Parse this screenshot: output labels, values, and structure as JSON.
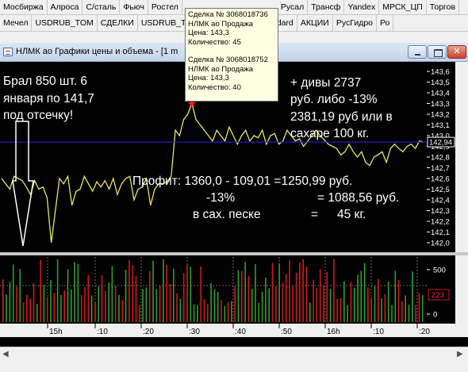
{
  "tabs_row1": [
    "Мосбиржа",
    "Алроса",
    "С/сталь",
    "Фьюч",
    "Ростел",
    "",
    "Русал",
    "Трансф",
    "Yandex",
    "МРСК_ЦП",
    "Торгов"
  ],
  "tabs_row2": [
    "Мечел",
    "USDRUB_TOM",
    "СДЕЛКИ",
    "USDRUB_TOD",
    "ап",
    "Торг RTS Standard",
    "АКЦИИ",
    "РусГидро",
    "Ро"
  ],
  "window": {
    "title": "НЛМК ао Графики цены и объема - [1 m",
    "close_glyph": "✕"
  },
  "tooltip": {
    "deal1": [
      "Сделка № 3068018736",
      "НЛМК ао Продажа",
      "Цена: 143,3",
      "Количество: 45"
    ],
    "deal2": [
      "Сделка № 3068018752",
      "НЛМК ао Продажа",
      "Цена: 143,3",
      "Количество: 40"
    ]
  },
  "annotations": {
    "left": [
      "Брал 850 шт. 6",
      "января по 141,7",
      "под отсечку!"
    ],
    "right": [
      "+ дивы   2737",
      "руб.   либо -13%",
      "2381,19 руб или в",
      "сахаре 100 кг."
    ],
    "profit": [
      "Профит:  1360,0 - 109,01  =1250,99 руб.",
      "-13%",
      "=  1088,56 руб.",
      "в сах. песке",
      "=",
      "45 кг."
    ]
  },
  "price_axis": {
    "ticks": [
      "143,6",
      "143,5",
      "143,4",
      "143,3",
      "143,2",
      "143,1",
      "143,0",
      "142,9",
      "142,8",
      "142,7",
      "142,6",
      "142,5",
      "142,4",
      "142,3",
      "142,2",
      "142,1",
      "142,0"
    ],
    "current": "142,94"
  },
  "volume_axis": {
    "ticks": [
      "500",
      "0"
    ],
    "current": "223"
  },
  "time_axis": [
    "15h",
    ":10",
    ":20",
    ":30",
    ":40",
    ":50",
    "16h",
    ":10",
    ":20"
  ],
  "colors": {
    "price_line": "#e8e85a",
    "buy_bar": "#2e9e2e",
    "sell_bar": "#d01a1a",
    "current_level": "#2020c0",
    "marker": "#ff2020"
  },
  "chart_data": {
    "type": "line",
    "series": [
      {
        "values": [
          142.6,
          142.55,
          142.5,
          142.62,
          142.6,
          142.58,
          142.52,
          142.45,
          142.58,
          142.5,
          142.52,
          142.42,
          142.0,
          142.3,
          142.6,
          142.55,
          142.62,
          142.35,
          142.48,
          142.5,
          142.62,
          142.55,
          142.48,
          142.57,
          142.52,
          142.58,
          142.5,
          142.6,
          142.45,
          142.55,
          142.6,
          142.62,
          142.4,
          142.5,
          142.52,
          142.6,
          142.35,
          142.5,
          142.55,
          142.55,
          142.57,
          142.62,
          143.05,
          143.0,
          143.15,
          143.2,
          143.3,
          143.15,
          143.1,
          143.05,
          143.0,
          142.95,
          143.05,
          143.0,
          142.95,
          143.08,
          143.0,
          142.92,
          143.0,
          143.05,
          142.95,
          143.0,
          142.98,
          143.05,
          142.92,
          143.0,
          143.02,
          142.92,
          142.95,
          143.05,
          143.0,
          142.95,
          142.97,
          142.9,
          142.95,
          143.0,
          143.05,
          143.0,
          142.96,
          142.92,
          142.9,
          142.88,
          142.82,
          142.85,
          142.92,
          142.85,
          142.8,
          142.85,
          142.75,
          142.72,
          142.8,
          142.82,
          142.85,
          142.75,
          142.88,
          142.92,
          142.88,
          142.85,
          142.9,
          142.92,
          142.88,
          142.95,
          142.94
        ]
      }
    ],
    "ylim": [
      142.0,
      143.6
    ]
  }
}
